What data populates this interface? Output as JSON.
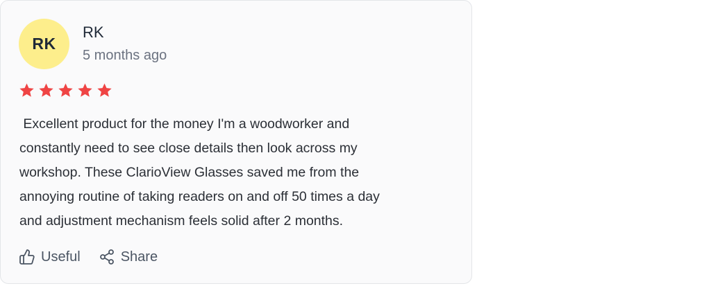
{
  "review": {
    "avatar_initials": "RK",
    "avatar_color": "#fdee8c",
    "reviewer_name": "RK",
    "time_ago": "5 months ago",
    "rating": 5,
    "rating_max": 5,
    "star_color": "#ef4444",
    "text": " Excellent product for the money I'm a woodworker and\nconstantly need to see close details then look across my\nworkshop. These ClarioView Glasses saved me from the\nannoying routine of taking readers on and off 50 times a day\nand adjustment mechanism feels solid after 2 months."
  },
  "actions": {
    "useful_label": "Useful",
    "useful_icon": "thumbs-up-icon",
    "share_label": "Share",
    "share_icon": "share-icon"
  }
}
